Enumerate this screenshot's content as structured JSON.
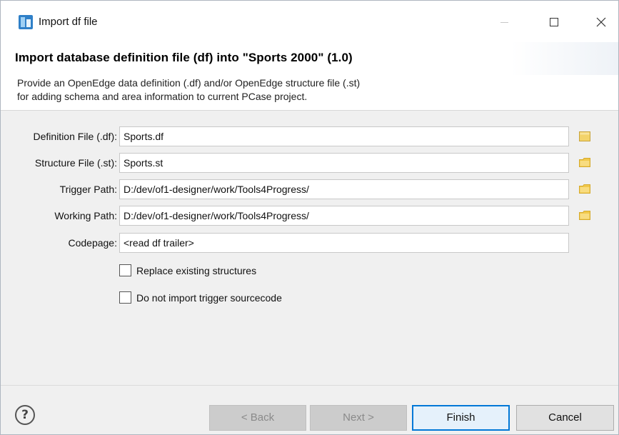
{
  "window": {
    "title": "Import df file",
    "icon": "eclipse-app-icon"
  },
  "header": {
    "title": "Import database definition file (df) into \"Sports 2000\" (1.0)",
    "description_line1": "Provide an OpenEdge data definition (.df) and/or OpenEdge structure file (.st)",
    "description_line2": "for adding schema and area information to current PCase project."
  },
  "form": {
    "definition_file": {
      "label": "Definition File (.df):",
      "value": "Sports.df"
    },
    "structure_file": {
      "label": "Structure File (.st):",
      "value": "Sports.st"
    },
    "trigger_path": {
      "label": "Trigger Path:",
      "value": "D:/dev/of1-designer/work/Tools4Progress/"
    },
    "working_path": {
      "label": "Working Path:",
      "value": "D:/dev/of1-designer/work/Tools4Progress/"
    },
    "codepage": {
      "label": "Codepage:",
      "value": "<read df trailer>"
    },
    "replace_existing": {
      "label": "Replace existing structures",
      "checked": false
    },
    "no_trigger_import": {
      "label": "Do not import trigger sourcecode",
      "checked": false
    }
  },
  "footer": {
    "help_symbol": "?",
    "back_label": "< Back",
    "next_label": "Next >",
    "finish_label": "Finish",
    "cancel_label": "Cancel"
  },
  "colors": {
    "accent": "#0078d7",
    "folder": "#f1c84b"
  }
}
